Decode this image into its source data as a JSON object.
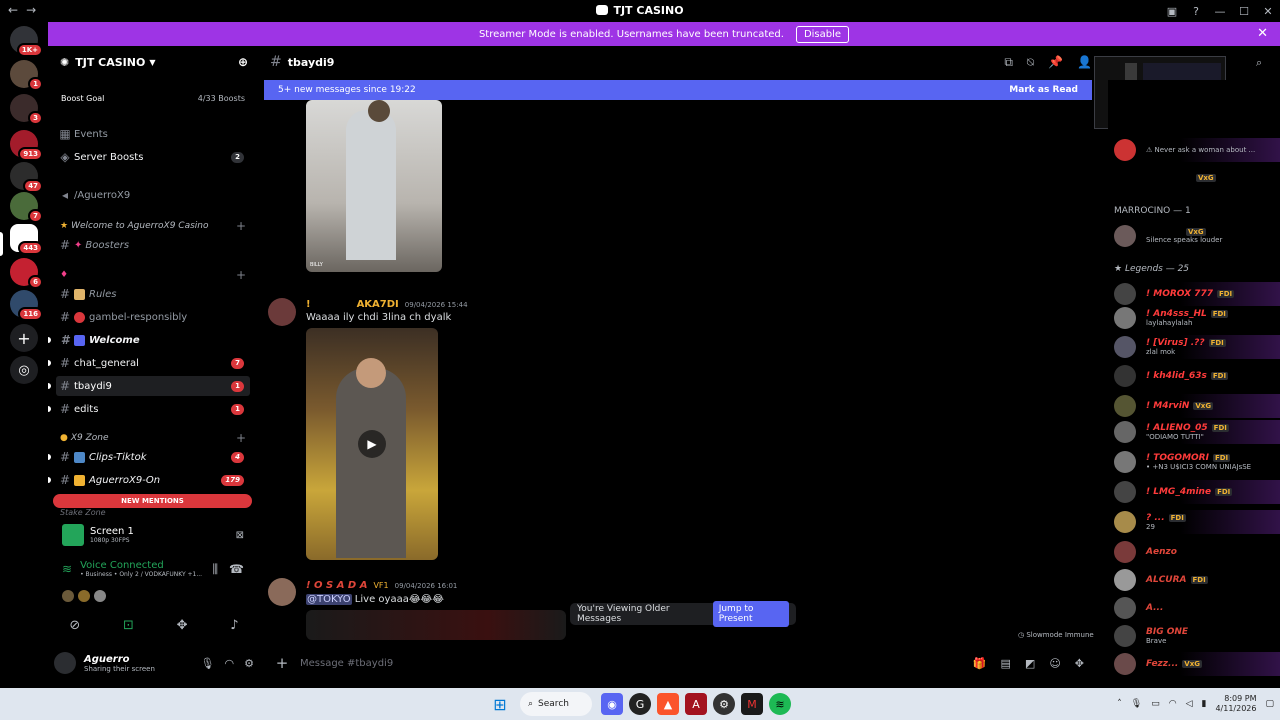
{
  "window": {
    "title": "TJT CASINO",
    "back": "←",
    "forward": "→"
  },
  "banner": {
    "text": "Streamer Mode is enabled. Usernames have been truncated.",
    "button": "Disable"
  },
  "servers": {
    "badges": [
      "1K+",
      "1",
      "3",
      "913",
      "47",
      "7",
      "443",
      "6",
      "116"
    ]
  },
  "guild": {
    "name": "TJT CASINO",
    "boost_label": "Boost Goal",
    "boost_value": "4/33 Boosts",
    "events": "Events",
    "server_boosts": "Server Boosts",
    "server_boosts_count": "2",
    "aguerro_channel": "/AguerroX9",
    "category1": "Welcome to AguerroX9 Casino",
    "boosters": "Boosters",
    "rules": "Rules",
    "gambel": "gambel-responsibly",
    "welcome": "Welcome",
    "chat_general": "chat_general",
    "chat_general_count": "7",
    "tbaydi9": "tbaydi9",
    "tbaydi9_count": "1",
    "edits": "edits",
    "edits_count": "1",
    "category2": "X9 Zone",
    "clips": "Clips-Tiktok",
    "clips_count": "4",
    "aguerro_on": "AguerroX9-On",
    "aguerro_on_count": "179",
    "new_mentions": "NEW MENTIONS",
    "stake_zone": "Stake Zone"
  },
  "voice": {
    "screen_label": "Screen 1",
    "screen_sub": "1080p 30FPS",
    "connected": "Voice Connected",
    "connected_sub": "• Business • Only 2 / VODKAFUNKY +1...",
    "user_name": "Aguerro",
    "user_status": "Sharing their screen"
  },
  "channel": {
    "name": "tbaydi9"
  },
  "newbar": {
    "text": "5+ new messages since 19:22",
    "action": "Mark as Read"
  },
  "messages": [
    {
      "author_prefix": "!",
      "author": "AKA7DI",
      "time": "09/04/2026 15:44",
      "text": "Waaaa ily chdi 3lina ch dyalk"
    },
    {
      "author": "! O S A D A",
      "tag": "VF1",
      "time": "09/04/2026 16:01",
      "mention": "@TOKYO",
      "text": " Live oyaaa😂😂😂"
    }
  ],
  "video_watermark": "BILLY",
  "older": {
    "text": "You're Viewing Older Messages",
    "button": "Jump to Present"
  },
  "slowmode": "Slowmode Immune",
  "composer": {
    "placeholder": "Message #tbaydi9"
  },
  "members": {
    "top_status": "Never ask a woman about ...",
    "vxg_tag": "VxG",
    "marrocino_header": "MARROCINO — 1",
    "marrocino_status": "Silence speaks louder",
    "legends_header": "Legends — 25",
    "list": [
      {
        "name": "! MOROX 777",
        "tag": "FDI",
        "sub": "",
        "color": "#ff3b3b"
      },
      {
        "name": "! An4sss_HL",
        "tag": "FDI",
        "sub": "laylahaylalah",
        "color": "#ff3b3b"
      },
      {
        "name": "! [Virus] .??",
        "tag": "FDI",
        "sub": "zlal mok",
        "color": "#ff3b3b"
      },
      {
        "name": "! kh4lid_63s",
        "tag": "FDI",
        "sub": "",
        "color": "#ff3b3b"
      },
      {
        "name": "! M4rviN",
        "tag": "VxG",
        "sub": "",
        "color": "#ff3b3b"
      },
      {
        "name": "! ALIENO_05",
        "tag": "FDI",
        "sub": "\"ODIAMO TUTTI\"",
        "color": "#ff3b3b"
      },
      {
        "name": "! TOGOMORI",
        "tag": "FDI",
        "sub": "• ﻿+N3 U$ICI3 COMN UNIAJsSE",
        "color": "#ff3b3b"
      },
      {
        "name": "! LMG_4mine",
        "tag": "FDI",
        "sub": "",
        "color": "#ff3b3b"
      },
      {
        "name": "? ...",
        "tag": "FDI",
        "sub": "29",
        "color": "#ff3b3b"
      },
      {
        "name": "Aenzo",
        "tag": "",
        "sub": "",
        "color": "#e0463a"
      },
      {
        "name": "ALCURA",
        "tag": "FDI",
        "sub": "",
        "color": "#e0463a"
      },
      {
        "name": "A...",
        "tag": "",
        "sub": "",
        "color": "#e0463a"
      },
      {
        "name": "BIG ONE",
        "tag": "",
        "sub": "Brave",
        "color": "#e0463a"
      },
      {
        "name": "Fezz...",
        "tag": "VxG",
        "sub": "",
        "color": "#e0463a"
      }
    ]
  },
  "taskbar": {
    "search": "Search",
    "time": "8:09 PM",
    "date": "4/11/2026"
  },
  "colors": {
    "accent": "#5865f2",
    "banner": "#9e34e5",
    "badge": "#da373c"
  }
}
